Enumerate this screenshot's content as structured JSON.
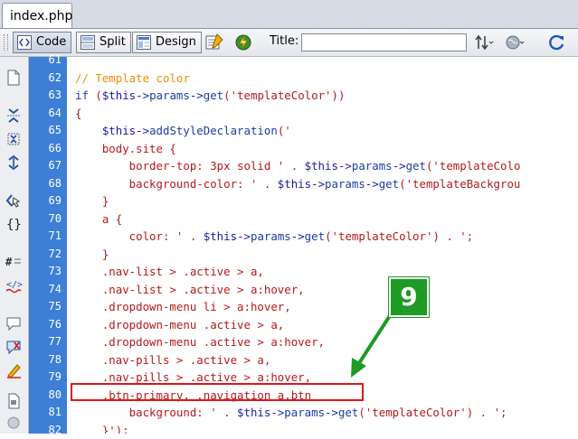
{
  "tab": {
    "filename": "index.php"
  },
  "toolbar": {
    "code_label": "Code",
    "split_label": "Split",
    "design_label": "Design",
    "title_label": "Title:",
    "title_value": ""
  },
  "gutter": {
    "line_numbers": [
      "61",
      "62",
      "63",
      "64",
      "65",
      "66",
      "67",
      "68",
      "69",
      "70",
      "71",
      "72",
      "73",
      "74",
      "75",
      "76",
      "77",
      "78",
      "79",
      "80",
      "81",
      "82"
    ]
  },
  "code_lines": [
    {
      "parts": []
    },
    {
      "parts": [
        {
          "c": "t-com",
          "t": "// Template color"
        }
      ]
    },
    {
      "parts": [
        {
          "c": "t-kw",
          "t": "if"
        },
        {
          "c": "t-txt",
          "t": " ("
        },
        {
          "c": "t-var",
          "t": "$this"
        },
        {
          "c": "t-op",
          "t": "->"
        },
        {
          "c": "t-fn",
          "t": "params"
        },
        {
          "c": "t-op",
          "t": "->"
        },
        {
          "c": "t-fn",
          "t": "get"
        },
        {
          "c": "t-txt",
          "t": "("
        },
        {
          "c": "t-str",
          "t": "'templateColor'"
        },
        {
          "c": "t-txt",
          "t": "))"
        }
      ]
    },
    {
      "parts": [
        {
          "c": "t-txt",
          "t": "{"
        }
      ]
    },
    {
      "parts": [
        {
          "c": "t-txt",
          "t": "    "
        },
        {
          "c": "t-var",
          "t": "$this"
        },
        {
          "c": "t-op",
          "t": "->"
        },
        {
          "c": "t-fn",
          "t": "addStyleDeclaration"
        },
        {
          "c": "t-txt",
          "t": "("
        },
        {
          "c": "t-str",
          "t": "'"
        }
      ]
    },
    {
      "parts": [
        {
          "c": "t-str",
          "t": "    body.site {"
        }
      ]
    },
    {
      "parts": [
        {
          "c": "t-str",
          "t": "        border-top: 3px solid ' . "
        },
        {
          "c": "t-var",
          "t": "$this"
        },
        {
          "c": "t-op",
          "t": "->"
        },
        {
          "c": "t-fn",
          "t": "params"
        },
        {
          "c": "t-op",
          "t": "->"
        },
        {
          "c": "t-fn",
          "t": "get"
        },
        {
          "c": "t-txt",
          "t": "("
        },
        {
          "c": "t-str",
          "t": "'templateColo"
        }
      ]
    },
    {
      "parts": [
        {
          "c": "t-str",
          "t": "        background-color: ' . "
        },
        {
          "c": "t-var",
          "t": "$this"
        },
        {
          "c": "t-op",
          "t": "->"
        },
        {
          "c": "t-fn",
          "t": "params"
        },
        {
          "c": "t-op",
          "t": "->"
        },
        {
          "c": "t-fn",
          "t": "get"
        },
        {
          "c": "t-txt",
          "t": "("
        },
        {
          "c": "t-str",
          "t": "'templateBackgrou"
        }
      ]
    },
    {
      "parts": [
        {
          "c": "t-str",
          "t": "    }"
        }
      ]
    },
    {
      "parts": [
        {
          "c": "t-str",
          "t": "    a {"
        }
      ]
    },
    {
      "parts": [
        {
          "c": "t-str",
          "t": "        color: ' . "
        },
        {
          "c": "t-var",
          "t": "$this"
        },
        {
          "c": "t-op",
          "t": "->"
        },
        {
          "c": "t-fn",
          "t": "params"
        },
        {
          "c": "t-op",
          "t": "->"
        },
        {
          "c": "t-fn",
          "t": "get"
        },
        {
          "c": "t-txt",
          "t": "("
        },
        {
          "c": "t-str",
          "t": "'templateColor'"
        },
        {
          "c": "t-txt",
          "t": ") . "
        },
        {
          "c": "t-str",
          "t": "';"
        }
      ]
    },
    {
      "parts": [
        {
          "c": "t-str",
          "t": "    }"
        }
      ]
    },
    {
      "parts": [
        {
          "c": "t-str",
          "t": "    .nav-list > .active > a,"
        }
      ]
    },
    {
      "parts": [
        {
          "c": "t-str",
          "t": "    .nav-list > .active > a:hover,"
        }
      ]
    },
    {
      "parts": [
        {
          "c": "t-str",
          "t": "    .dropdown-menu li > a:hover,"
        }
      ]
    },
    {
      "parts": [
        {
          "c": "t-str",
          "t": "    .dropdown-menu .active > a,"
        }
      ]
    },
    {
      "parts": [
        {
          "c": "t-str",
          "t": "    .dropdown-menu .active > a:hover,"
        }
      ]
    },
    {
      "parts": [
        {
          "c": "t-str",
          "t": "    .nav-pills > .active > a,"
        }
      ]
    },
    {
      "parts": [
        {
          "c": "t-str",
          "t": "    .nav-pills > .active > a:hover,"
        }
      ]
    },
    {
      "parts": [
        {
          "c": "t-str",
          "t": "    .btn-primary, .navigation a.btn"
        }
      ]
    },
    {
      "parts": [
        {
          "c": "t-str",
          "t": "        background: ' . "
        },
        {
          "c": "t-var",
          "t": "$this"
        },
        {
          "c": "t-op",
          "t": "->"
        },
        {
          "c": "t-fn",
          "t": "params"
        },
        {
          "c": "t-op",
          "t": "->"
        },
        {
          "c": "t-fn",
          "t": "get"
        },
        {
          "c": "t-txt",
          "t": "("
        },
        {
          "c": "t-str",
          "t": "'templateColor'"
        },
        {
          "c": "t-txt",
          "t": ") . "
        },
        {
          "c": "t-str",
          "t": "';"
        }
      ]
    },
    {
      "parts": [
        {
          "c": "t-str",
          "t": "    }');"
        }
      ]
    }
  ],
  "callout": {
    "number": "9",
    "color": "#1f9a25",
    "highlight_color": "#e0161a"
  },
  "icons": {
    "toolbar": [
      "code-view-icon",
      "split-view-icon",
      "design-view-icon",
      "live-view-icon",
      "refresh-design-icon",
      "file-management-icon",
      "preview-browser-icon",
      "refresh-icon"
    ],
    "left_toolbar": [
      "open-documents-icon",
      "collapse-tag-icon",
      "collapse-selection-icon",
      "expand-all-icon",
      "select-parent-tag-icon",
      "balance-braces-icon",
      "line-numbers-icon",
      "highlight-invalid-code-icon",
      "apply-comment-icon",
      "remove-comment-icon",
      "wrap-tag-icon",
      "recent-snippets-icon",
      "move-css-icon"
    ]
  }
}
